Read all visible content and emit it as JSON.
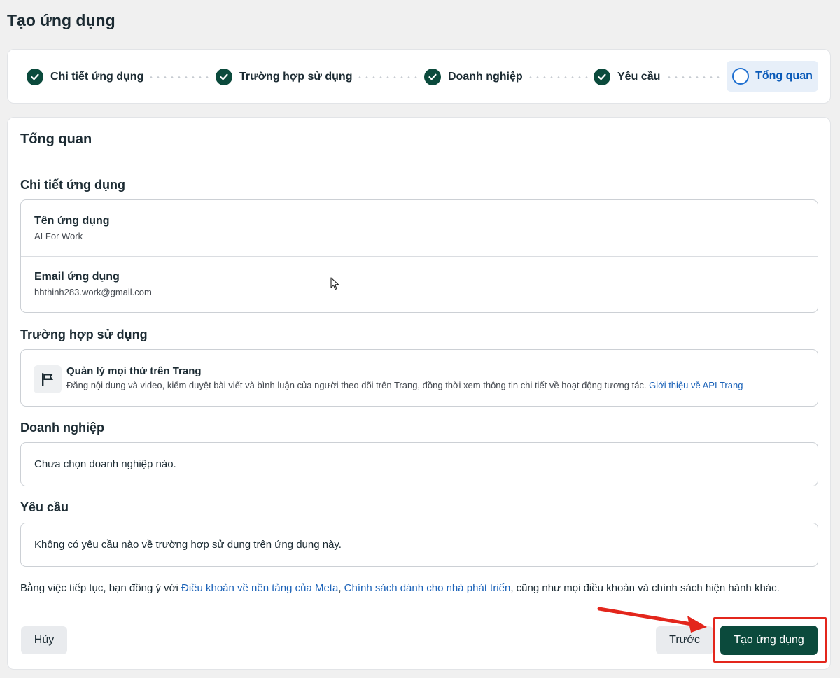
{
  "page": {
    "title": "Tạo ứng dụng"
  },
  "stepper": {
    "steps": [
      {
        "label": "Chi tiết ứng dụng",
        "status": "done"
      },
      {
        "label": "Trường hợp sử dụng",
        "status": "done"
      },
      {
        "label": "Doanh nghiệp",
        "status": "done"
      },
      {
        "label": "Yêu cầu",
        "status": "done"
      },
      {
        "label": "Tổng quan",
        "status": "active"
      }
    ]
  },
  "overview": {
    "title": "Tổng quan",
    "app_details": {
      "heading": "Chi tiết ứng dụng",
      "name_label": "Tên ứng dụng",
      "name_value": "AI For Work",
      "email_label": "Email ứng dụng",
      "email_value": "hhthinh283.work@gmail.com"
    },
    "use_case": {
      "heading": "Trường hợp sử dụng",
      "icon": "flag-icon",
      "title": "Quản lý mọi thứ trên Trang",
      "description": "Đăng nội dung và video, kiểm duyệt bài viết và bình luận của người theo dõi trên Trang, đồng thời xem thông tin chi tiết về hoạt động tương tác.",
      "link": "Giới thiệu về API Trang"
    },
    "business": {
      "heading": "Doanh nghiệp",
      "value": "Chưa chọn doanh nghiệp nào."
    },
    "requirements": {
      "heading": "Yêu cầu",
      "value": "Không có yêu cầu nào về trường hợp sử dụng trên ứng dụng này."
    },
    "terms": {
      "prefix": "Bằng việc tiếp tục, bạn đồng ý với ",
      "link1": "Điều khoản về nền tảng của Meta",
      "sep": ", ",
      "link2": "Chính sách dành cho nhà phát triển",
      "suffix": ", cũng như mọi điều khoản và chính sách hiện hành khác."
    }
  },
  "buttons": {
    "cancel": "Hủy",
    "back": "Trước",
    "create": "Tạo ứng dụng"
  },
  "colors": {
    "primary": "#0b4a3c",
    "link": "#1b62b8",
    "active_step_bg": "#e7eff9",
    "annotation": "#e3261c"
  }
}
